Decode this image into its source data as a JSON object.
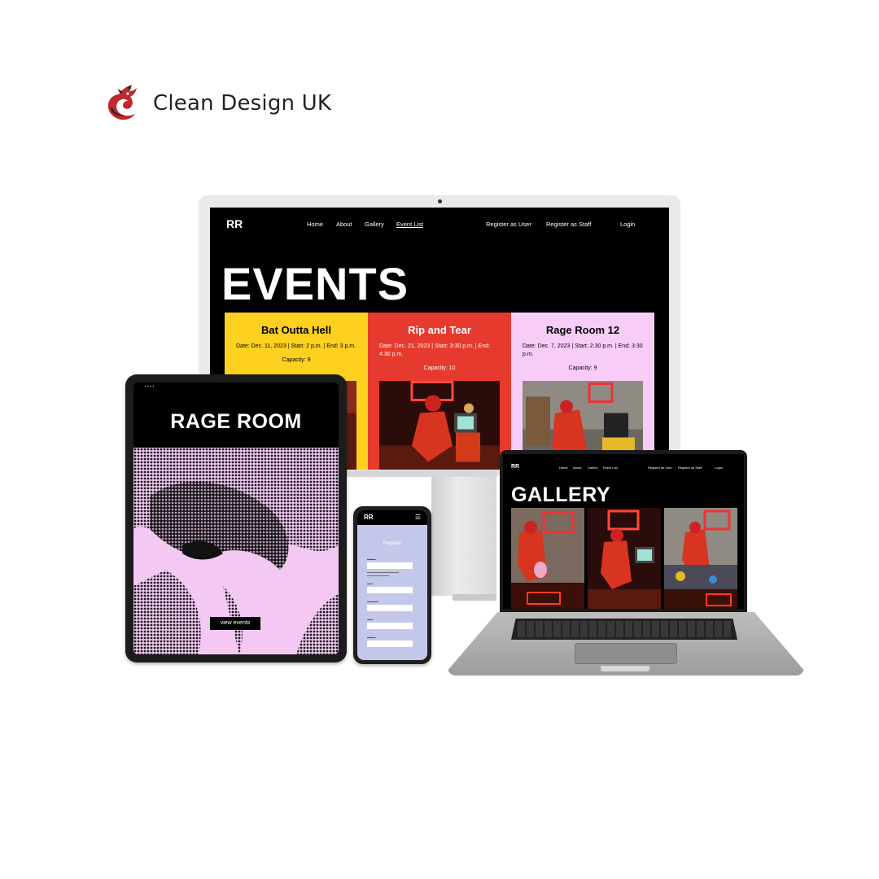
{
  "brand": {
    "name": "Clean Design UK",
    "logo_icon": "red-dragon-logo",
    "accent": "#c1272d"
  },
  "desktop": {
    "nav": {
      "logo": "RR",
      "links": [
        "Home",
        "About",
        "Gallery",
        "Event List"
      ],
      "active": "Event List",
      "actions": [
        "Register as User",
        "Register as Staff",
        "Login"
      ]
    },
    "heading": "EVENTS",
    "events": [
      {
        "title": "Bat Outta Hell",
        "date": "Date: Dec. 11, 2023 | Start: 2 p.m. | End: 3 p.m.",
        "capacity": "Capacity: 9",
        "color": "#fed020"
      },
      {
        "title": "Rip and Tear",
        "date": "Date: Dec. 21, 2023 | Start: 3:30 p.m. | End: 4:30 p.m.",
        "capacity": "Capacity: 10",
        "color": "#e63a2e"
      },
      {
        "title": "Rage Room 12",
        "date": "Date: Dec. 7, 2023 | Start: 2:30 p.m. | End: 3:30 p.m.",
        "capacity": "Capacity: 9",
        "color": "#f7cdf7"
      }
    ]
  },
  "tablet": {
    "title": "RAGE ROOM",
    "cta": "view events",
    "hero_color": "#f3c9f3"
  },
  "phone": {
    "logo": "RR",
    "menu_icon": "hamburger-icon",
    "heading": "Register"
  },
  "laptop": {
    "nav": {
      "logo": "RR",
      "links": [
        "Home",
        "About",
        "Gallery",
        "Event List"
      ],
      "actions": [
        "Register as User",
        "Register as Staff",
        "Login"
      ]
    },
    "heading": "GALLERY"
  }
}
